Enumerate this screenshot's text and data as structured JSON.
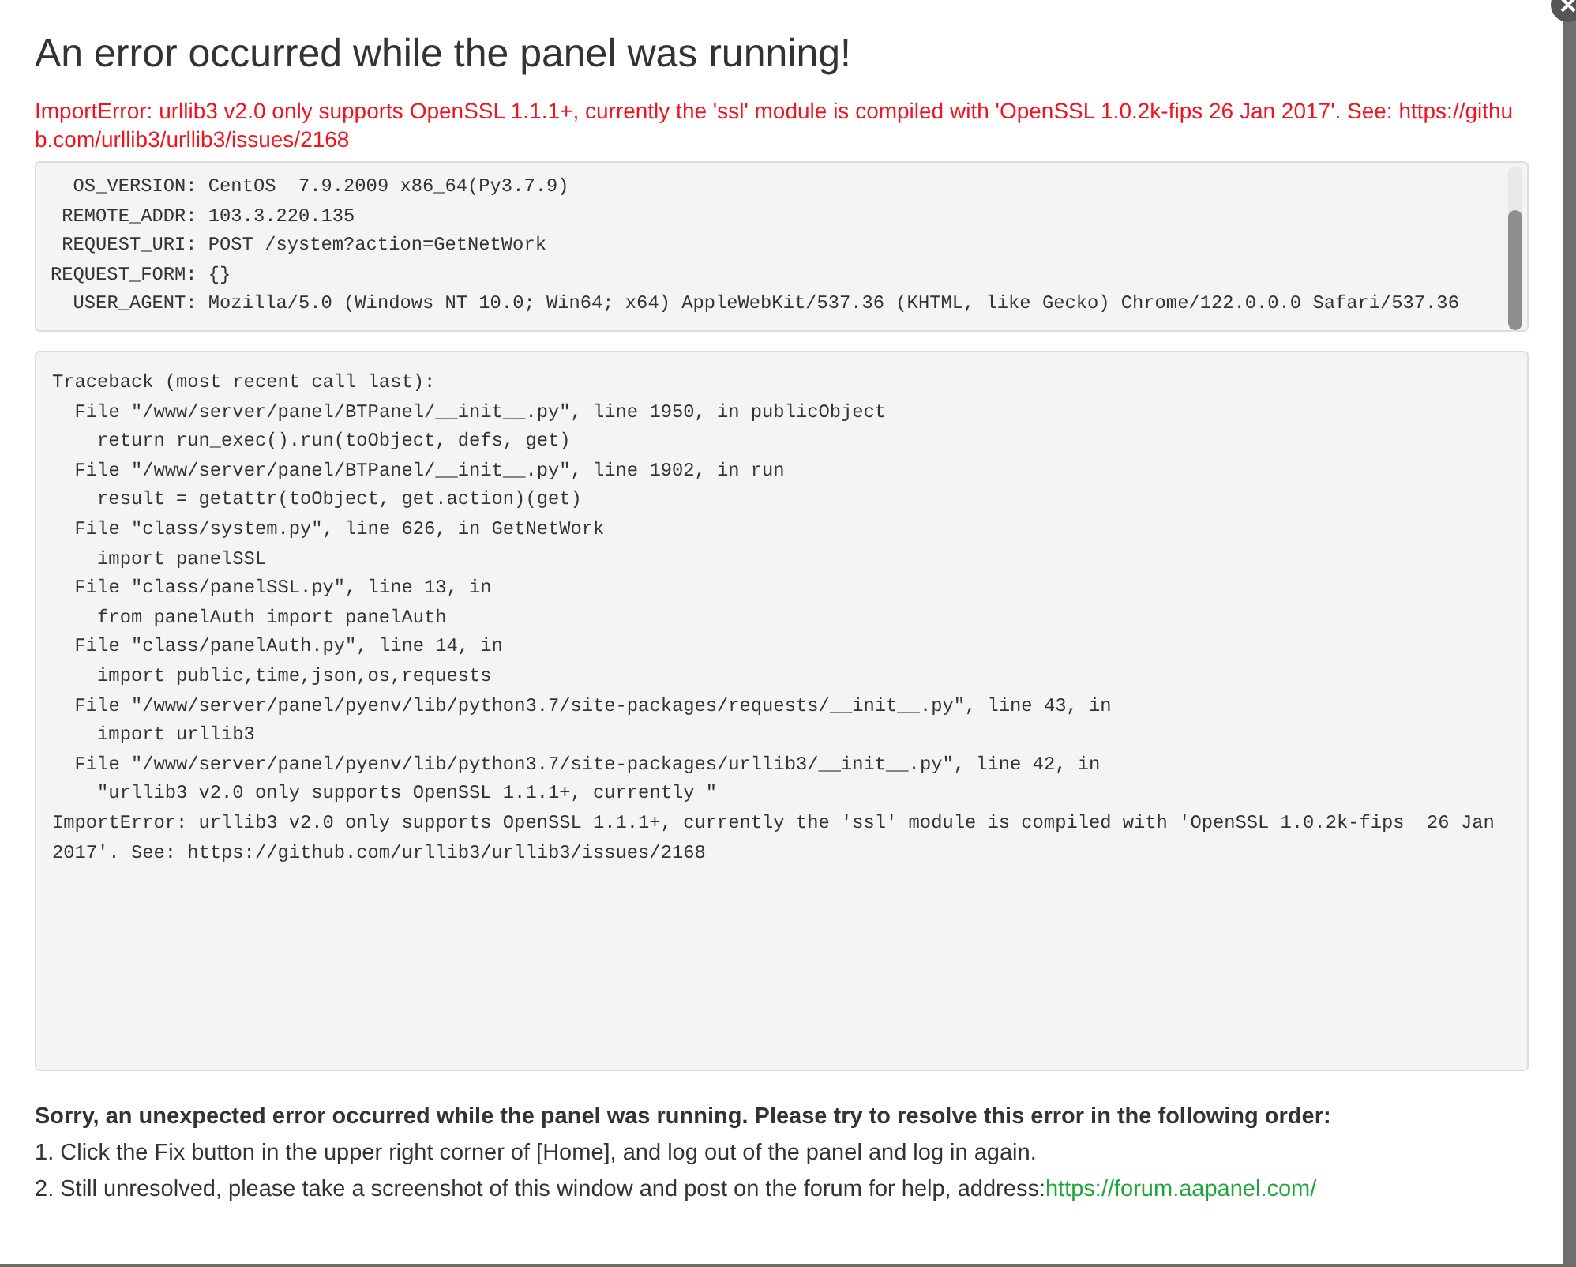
{
  "dialog": {
    "title": "An error occurred while the panel was running!",
    "error_message": "ImportError: urllib3 v2.0 only supports OpenSSL 1.1.1+, currently the 'ssl' module is compiled with 'OpenSSL 1.0.2k-fips 26 Jan 2017'. See: https://github.com/urllib3/urllib3/issues/2168",
    "environment_lines": [
      "  OS_VERSION: CentOS  7.9.2009 x86_64(Py3.7.9)",
      " REMOTE_ADDR: 103.3.220.135",
      " REQUEST_URI: POST /system?action=GetNetWork",
      "REQUEST_FORM: {}",
      "  USER_AGENT: Mozilla/5.0 (Windows NT 10.0; Win64; x64) AppleWebKit/537.36 (KHTML, like Gecko) Chrome/122.0.0.0 Safari/537.36"
    ],
    "traceback_lines": [
      "Traceback (most recent call last):",
      "  File \"/www/server/panel/BTPanel/__init__.py\", line 1950, in publicObject",
      "    return run_exec().run(toObject, defs, get)",
      "  File \"/www/server/panel/BTPanel/__init__.py\", line 1902, in run",
      "    result = getattr(toObject, get.action)(get)",
      "  File \"class/system.py\", line 626, in GetNetWork",
      "    import panelSSL",
      "  File \"class/panelSSL.py\", line 13, in",
      "    from panelAuth import panelAuth",
      "  File \"class/panelAuth.py\", line 14, in",
      "    import public,time,json,os,requests",
      "  File \"/www/server/panel/pyenv/lib/python3.7/site-packages/requests/__init__.py\", line 43, in",
      "    import urllib3",
      "  File \"/www/server/panel/pyenv/lib/python3.7/site-packages/urllib3/__init__.py\", line 42, in",
      "    \"urllib3 v2.0 only supports OpenSSL 1.1.1+, currently \"",
      "ImportError: urllib3 v2.0 only supports OpenSSL 1.1.1+, currently the 'ssl' module is compiled with 'OpenSSL 1.0.2k-fips  26 Jan 2017'. See: https://github.com/urllib3/urllib3/issues/2168"
    ],
    "help_heading": "Sorry, an unexpected error occurred while the panel was running. Please try to resolve this error in the following order:",
    "steps": [
      {
        "text": "1. Click the Fix button in the upper right corner of [Home], and log out of the panel and log in again."
      },
      {
        "text": "2. Still unresolved, please take a screenshot of this window and post on the forum for help, address:",
        "link": "https://forum.aapanel.com/"
      }
    ]
  }
}
